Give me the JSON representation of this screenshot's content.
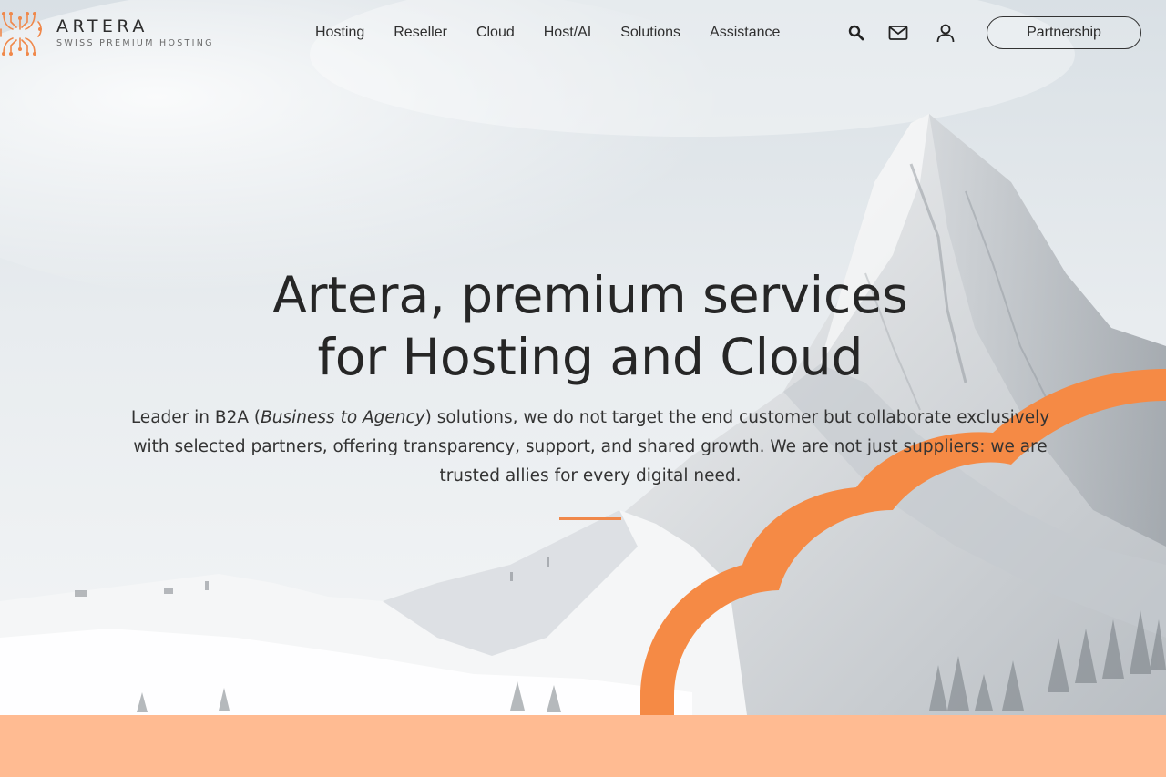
{
  "brand": {
    "name": "ARTERA",
    "tagline": "SWISS PREMIUM HOSTING",
    "logo_icon": "circuit-logo-icon",
    "accent_color": "#f0884a"
  },
  "nav": {
    "items": [
      {
        "label": "Hosting"
      },
      {
        "label": "Reseller"
      },
      {
        "label": "Cloud"
      },
      {
        "label": "Host/AI"
      },
      {
        "label": "Solutions"
      },
      {
        "label": "Assistance"
      }
    ]
  },
  "tools": {
    "search_icon": "search-icon",
    "mail_icon": "mail-icon",
    "user_icon": "user-icon"
  },
  "cta": {
    "partnership_label": "Partnership"
  },
  "hero": {
    "title_line1": "Artera, premium services",
    "title_line2": "for Hosting and Cloud",
    "desc_prefix": "Leader in B2A (",
    "desc_em": "Business to Agency",
    "desc_suffix": ") solutions, we do not target the end customer but collaborate exclusively with selected partners, offering transparency, support, and shared growth. We are not just suppliers: we are trusted allies for every digital need.",
    "background": "snowy-matterhorn-photo",
    "cloud_shape_color": "#f58a45"
  },
  "band": {
    "color": "#ffbb92"
  }
}
